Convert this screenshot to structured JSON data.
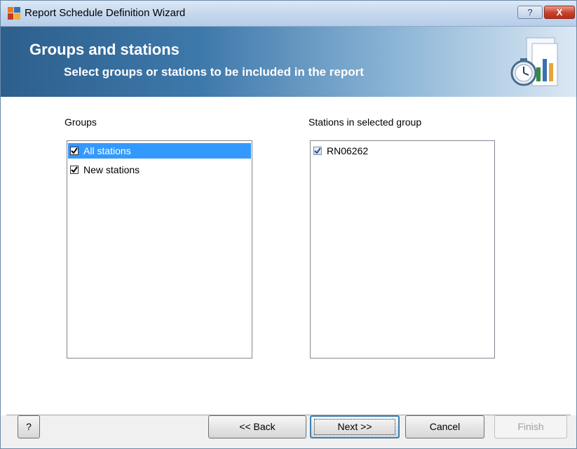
{
  "window": {
    "title": "Report Schedule Definition Wizard",
    "help_glyph": "?",
    "close_glyph": "X"
  },
  "banner": {
    "title": "Groups and stations",
    "subtitle": "Select groups or stations to be included in the report",
    "icon": "report-schedule-icon"
  },
  "groups": {
    "label": "Groups",
    "items": [
      {
        "label": "All stations",
        "checked": true,
        "selected": true
      },
      {
        "label": "New stations",
        "checked": true,
        "selected": false
      }
    ]
  },
  "stations": {
    "label": "Stations in selected group",
    "items": [
      {
        "label": "RN06262",
        "checked": true,
        "selected": false
      }
    ]
  },
  "footer": {
    "help_label": "?",
    "back_label": "<< Back",
    "next_label": "Next >>",
    "cancel_label": "Cancel",
    "finish_label": "Finish"
  },
  "colors": {
    "selection": "#3399ff",
    "banner_start": "#2d5f8c",
    "banner_end": "#dbe8f3"
  }
}
